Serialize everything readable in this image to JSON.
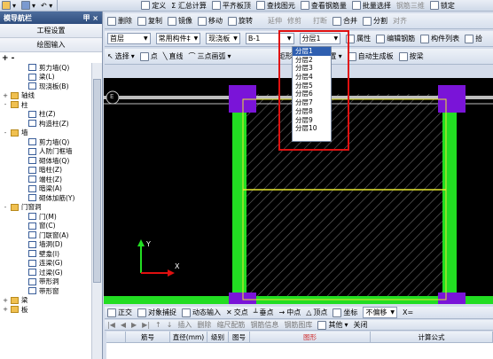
{
  "menu": {
    "items_left": [
      "定义",
      "Σ 汇总计算",
      "平齐板顶",
      "查找图元",
      "查看钢筋量",
      "批量选择",
      "钢筋三维",
      "锁定"
    ]
  },
  "nav": {
    "title": "模导航栏",
    "pin": "甲 ×",
    "buttons": [
      "工程设置",
      "绘图输入"
    ],
    "plusminus": "+ -",
    "tree": [
      {
        "indent": 2,
        "box": "",
        "icon": "leaf",
        "label": "剪力墙(Q)"
      },
      {
        "indent": 2,
        "box": "",
        "icon": "leaf",
        "label": "梁(L)"
      },
      {
        "indent": 2,
        "box": "",
        "icon": "leaf",
        "label": "现浇板(B)"
      },
      {
        "indent": 0,
        "box": "+",
        "icon": "folder",
        "label": "轴线"
      },
      {
        "indent": 0,
        "box": "-",
        "icon": "folder",
        "label": "柱"
      },
      {
        "indent": 2,
        "box": "",
        "icon": "leaf",
        "label": "柱(Z)"
      },
      {
        "indent": 2,
        "box": "",
        "icon": "leaf",
        "label": "构造柱(Z)"
      },
      {
        "indent": 0,
        "box": "-",
        "icon": "folder",
        "label": "墙"
      },
      {
        "indent": 2,
        "box": "",
        "icon": "leaf",
        "label": "剪力墙(Q)"
      },
      {
        "indent": 2,
        "box": "",
        "icon": "leaf",
        "label": "人防门框墙"
      },
      {
        "indent": 2,
        "box": "",
        "icon": "leaf",
        "label": "砌体墙(Q)"
      },
      {
        "indent": 2,
        "box": "",
        "icon": "leaf",
        "label": "暗柱(Z)"
      },
      {
        "indent": 2,
        "box": "",
        "icon": "leaf",
        "label": "端柱(Z)"
      },
      {
        "indent": 2,
        "box": "",
        "icon": "leaf",
        "label": "暗梁(A)"
      },
      {
        "indent": 2,
        "box": "",
        "icon": "leaf",
        "label": "砌体加筋(Y)"
      },
      {
        "indent": 0,
        "box": "-",
        "icon": "folder",
        "label": "门窗洞"
      },
      {
        "indent": 2,
        "box": "",
        "icon": "leaf",
        "label": "门(M)"
      },
      {
        "indent": 2,
        "box": "",
        "icon": "leaf",
        "label": "窗(C)"
      },
      {
        "indent": 2,
        "box": "",
        "icon": "leaf",
        "label": "门联窗(A)"
      },
      {
        "indent": 2,
        "box": "",
        "icon": "leaf",
        "label": "墙洞(D)"
      },
      {
        "indent": 2,
        "box": "",
        "icon": "leaf",
        "label": "壁龛(I)"
      },
      {
        "indent": 2,
        "box": "",
        "icon": "leaf",
        "label": "连梁(G)"
      },
      {
        "indent": 2,
        "box": "",
        "icon": "leaf",
        "label": "过梁(G)"
      },
      {
        "indent": 2,
        "box": "",
        "icon": "leaf",
        "label": "带形洞"
      },
      {
        "indent": 2,
        "box": "",
        "icon": "leaf",
        "label": "带形窗"
      },
      {
        "indent": 0,
        "box": "+",
        "icon": "folder",
        "label": "梁"
      },
      {
        "indent": 0,
        "box": "+",
        "icon": "folder",
        "label": "板"
      }
    ]
  },
  "toolbar1": {
    "items": [
      "删除",
      "复制",
      "镜像",
      "移动",
      "旋转",
      "延伸",
      "修剪",
      "打断",
      "合并",
      "分割",
      "对齐"
    ]
  },
  "toolbar2": {
    "floor": "首层",
    "category": "常用构件‡",
    "type": "现浇板",
    "name": "B-1",
    "layer": "分层1",
    "items": [
      "属性",
      "编辑钢筋",
      "构件列表",
      "拾"
    ]
  },
  "toolbar3": {
    "items": [
      "选择",
      "点",
      "直线",
      "三点画弧",
      "矩形",
      "智能布置",
      "自动生成板",
      "按梁"
    ]
  },
  "layer_dropdown": {
    "options": [
      "分层1",
      "分层2",
      "分层3",
      "分层4",
      "分层5",
      "分层6",
      "分层7",
      "分层8",
      "分层9",
      "分层10"
    ],
    "selected": "分层1"
  },
  "canvas": {
    "axis_label": "E",
    "axis_y": "Y",
    "axis_x": "X"
  },
  "statusbar": {
    "items": [
      "正交",
      "对象捕捉",
      "动态输入",
      "交点",
      "垂点",
      "中点",
      "顶点",
      "坐标",
      "不偏移"
    ],
    "x_label": "X="
  },
  "gridbar": {
    "items": [
      "插入",
      "删除",
      "缩尺配筋",
      "钢筋信息",
      "钢筋图库",
      "其他",
      "关闭"
    ]
  },
  "grid_headers": [
    "筋号",
    "直径(mm)",
    "级别",
    "图号",
    "图形",
    "计算公式"
  ],
  "colors": {
    "column": "#7a14d8",
    "wall": "#22dd22",
    "beam_line": "#e8e830",
    "red_box": "#e01010"
  }
}
